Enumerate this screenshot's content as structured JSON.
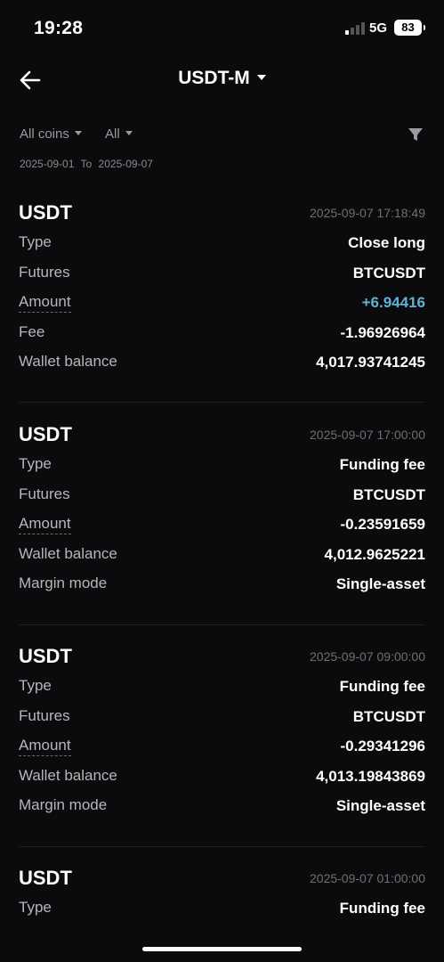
{
  "status_bar": {
    "time": "19:28",
    "network": "5G",
    "battery": "83"
  },
  "header": {
    "title": "USDT-M"
  },
  "filters": {
    "coins": "All coins",
    "type": "All"
  },
  "date_range": {
    "from": "2025-09-01",
    "to_label": "To",
    "to": "2025-09-07"
  },
  "records": [
    {
      "coin": "USDT",
      "time": "2025-09-07 17:18:49",
      "rows": [
        {
          "label": "Type",
          "value": "Close long"
        },
        {
          "label": "Futures",
          "value": "BTCUSDT"
        },
        {
          "label": "Amount",
          "value": "+6.94416"
        },
        {
          "label": "Fee",
          "value": "-1.96926964"
        },
        {
          "label": "Wallet balance",
          "value": "4,017.93741245"
        }
      ]
    },
    {
      "coin": "USDT",
      "time": "2025-09-07 17:00:00",
      "rows": [
        {
          "label": "Type",
          "value": "Funding fee"
        },
        {
          "label": "Futures",
          "value": "BTCUSDT"
        },
        {
          "label": "Amount",
          "value": "-0.23591659"
        },
        {
          "label": "Wallet balance",
          "value": "4,012.9625221"
        },
        {
          "label": "Margin mode",
          "value": "Single-asset"
        }
      ]
    },
    {
      "coin": "USDT",
      "time": "2025-09-07 09:00:00",
      "rows": [
        {
          "label": "Type",
          "value": "Funding fee"
        },
        {
          "label": "Futures",
          "value": "BTCUSDT"
        },
        {
          "label": "Amount",
          "value": "-0.29341296"
        },
        {
          "label": "Wallet balance",
          "value": "4,013.19843869"
        },
        {
          "label": "Margin mode",
          "value": "Single-asset"
        }
      ]
    },
    {
      "coin": "USDT",
      "time": "2025-09-07 01:00:00",
      "rows": [
        {
          "label": "Type",
          "value": "Funding fee"
        }
      ]
    }
  ],
  "colors": {
    "background": "#0b0b0d",
    "positive": "#5fb3d6",
    "muted": "#9a9a9e"
  }
}
